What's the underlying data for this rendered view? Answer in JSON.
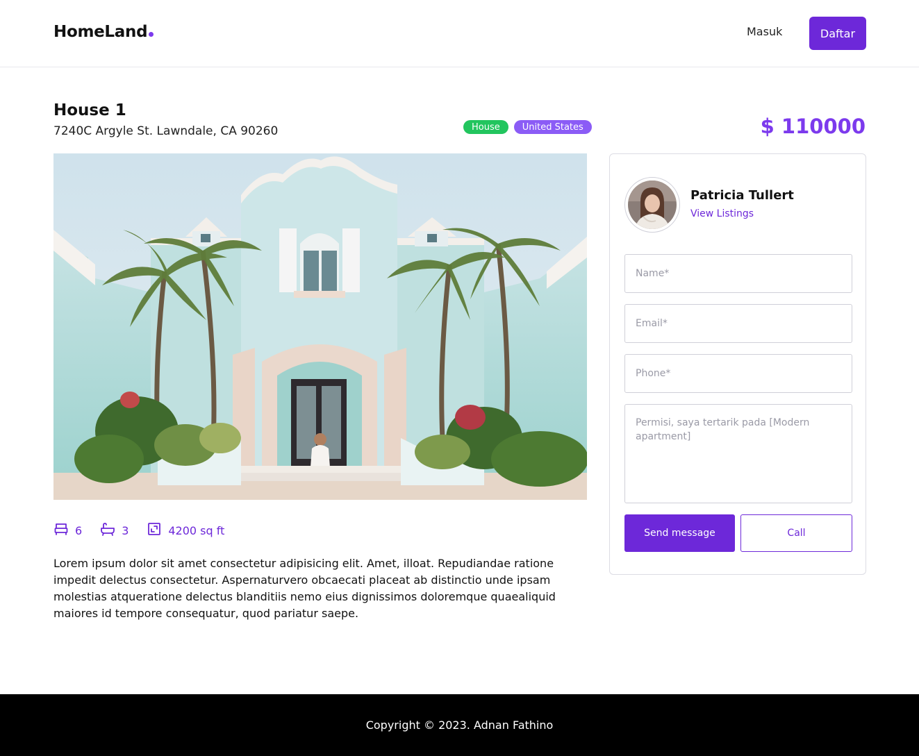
{
  "header": {
    "logo": "HomeLand",
    "login_label": "Masuk",
    "register_label": "Daftar"
  },
  "listing": {
    "title": "House 1",
    "address": "7240C Argyle St. Lawndale, CA 90260",
    "badges": [
      "House",
      "United States"
    ],
    "price": "$ 110000",
    "bedrooms": "6",
    "bathrooms": "3",
    "area": "4200 sq ft",
    "description": "Lorem ipsum dolor sit amet consectetur adipisicing elit. Amet, illoat. Repudiandae ratione impedit delectus consectetur. Aspernaturvero obcaecati placeat ab distinctio unde ipsam molestias atqueratione delectus blanditiis nemo eius dignissimos doloremque quaealiquid maiores id tempore consequatur, quod pariatur saepe."
  },
  "agent": {
    "name": "Patricia Tullert",
    "link_label": "View Listings"
  },
  "form": {
    "name_placeholder": "Name*",
    "email_placeholder": "Email*",
    "phone_placeholder": "Phone*",
    "message_placeholder": "Permisi, saya tertarik pada [Modern apartment]",
    "send_label": "Send message",
    "call_label": "Call"
  },
  "footer": {
    "copyright": "Copyright © 2023. Adnan Fathino"
  },
  "icons": {
    "bed": "bed-icon",
    "bath": "bathtub-icon",
    "area": "area-icon"
  },
  "colors": {
    "accent": "#6d28d9",
    "badge_house": "#22c55e",
    "badge_country": "#8b5cf6"
  }
}
